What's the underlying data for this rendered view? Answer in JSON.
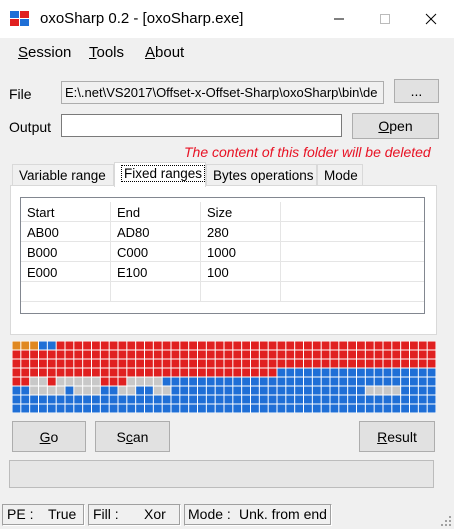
{
  "window": {
    "title": "oxoSharp 0.2 - [oxoSharp.exe]",
    "controls": {
      "minimize": "–",
      "maximize": "□",
      "close": "✕"
    }
  },
  "menu": [
    {
      "accel": "S",
      "rest": "ession"
    },
    {
      "accel": "T",
      "rest": "ools"
    },
    {
      "accel": "A",
      "rest": "bout"
    }
  ],
  "file": {
    "label": "File",
    "value": "E:\\.net\\VS2017\\Offset-x-Offset-Sharp\\oxoSharp\\bin\\de",
    "browse_label": "..."
  },
  "output": {
    "label": "Output",
    "value": "",
    "open_accel": "O",
    "open_rest": "pen"
  },
  "warning": "The content of this folder will be deleted",
  "tabs": [
    "Variable range",
    "Fixed ranges",
    "Bytes operations",
    "Mode"
  ],
  "active_tab": "Fixed ranges",
  "ranges_table": {
    "headers": [
      "Start",
      "End",
      "Size"
    ],
    "rows": [
      [
        "AB00",
        "AD80",
        "280"
      ],
      [
        "B000",
        "C000",
        "1000"
      ],
      [
        "E000",
        "E100",
        "100"
      ]
    ]
  },
  "block_map": {
    "columns": 48,
    "rows": 8,
    "colors": {
      "red": "#e02020",
      "blue": "#1f6fd6",
      "gray": "#c8c8c8",
      "orange": "#e08820"
    }
  },
  "buttons": {
    "go_accel": "G",
    "go_rest": "o",
    "scan_pre": "S",
    "scan_accel": "c",
    "scan_rest": "an",
    "result_accel": "R",
    "result_rest": "esult"
  },
  "statusbar": {
    "pe_label": "PE :",
    "pe_value": "True",
    "fill_label": "Fill :",
    "fill_value": "Xor",
    "mode_label": "Mode :",
    "mode_value": "Unk. from end"
  },
  "colors": {
    "warning": "#e81123",
    "accent_blue": "#1f6fd6",
    "accent_red": "#e02020"
  }
}
